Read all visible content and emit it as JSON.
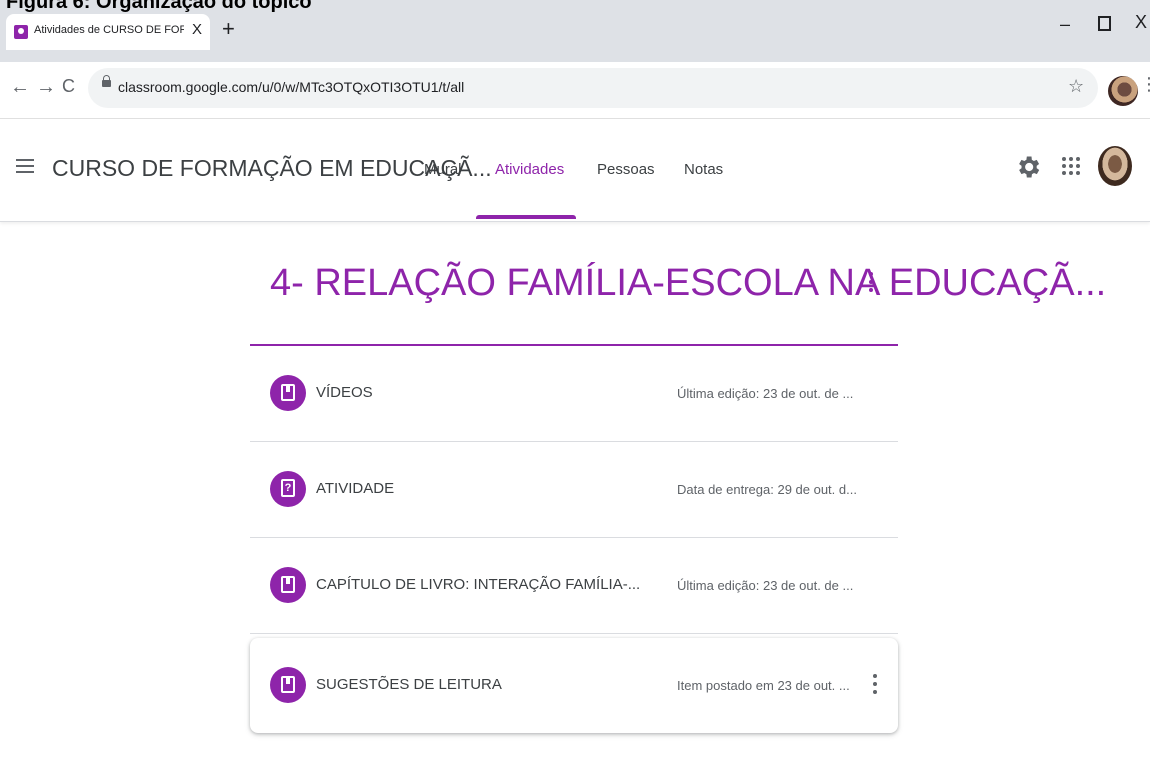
{
  "document_caption": "Figura 6: Organização do tópico",
  "browser": {
    "tab_title": "Atividades de CURSO DE FORMAÇÃO",
    "tab_close": "X",
    "new_tab": "+",
    "win_min": "–",
    "win_close": "X",
    "url": "classroom.google.com/u/0/w/MTc3OTQxOTI3OTU1/t/all",
    "back": "←",
    "forward": "→",
    "reload": "C",
    "star": "☆",
    "menu": "⋮"
  },
  "header": {
    "course_name": "CURSO DE FORMAÇÃO EM EDUCAÇÃ...",
    "tabs": [
      {
        "label": "Mural"
      },
      {
        "label": "Atividades"
      },
      {
        "label": "Pessoas"
      },
      {
        "label": "Notas"
      }
    ],
    "active_tab": "Atividades",
    "accent": "#8e24aa"
  },
  "topic": {
    "title": "4- RELAÇÃO FAMÍLIA-ESCOLA NA EDUCAÇÃ...",
    "items": [
      {
        "icon": "material-icon",
        "title": "VÍDEOS",
        "meta": "Última edição: 23 de out. de ..."
      },
      {
        "icon": "question-icon",
        "title": "ATIVIDADE",
        "meta": "Data de entrega: 29 de out. d..."
      },
      {
        "icon": "material-icon",
        "title": "CAPÍTULO DE LIVRO: INTERAÇÃO FAMÍLIA-...",
        "meta": "Última edição: 23 de out. de ..."
      },
      {
        "icon": "material-icon",
        "title": "SUGESTÕES DE LEITURA",
        "meta": "Item postado em 23 de out. ..."
      }
    ]
  }
}
